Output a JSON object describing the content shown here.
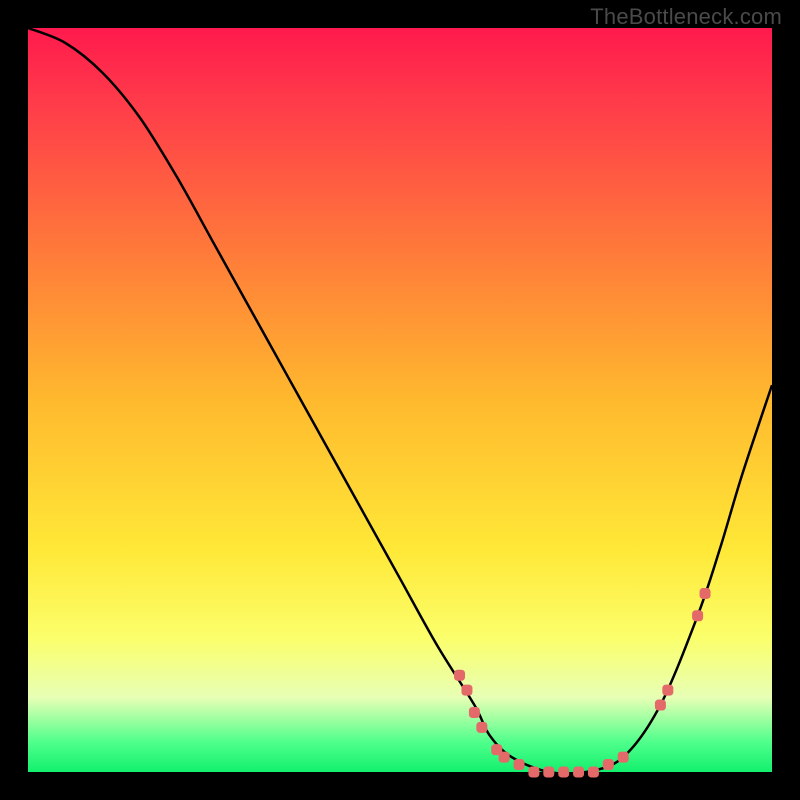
{
  "watermark": "TheBottleneck.com",
  "chart_data": {
    "type": "line",
    "title": "",
    "xlabel": "",
    "ylabel": "",
    "xlim": [
      0,
      100
    ],
    "ylim": [
      0,
      100
    ],
    "series": [
      {
        "name": "curve",
        "x": [
          0,
          5,
          10,
          15,
          20,
          25,
          30,
          35,
          40,
          45,
          50,
          55,
          60,
          62,
          65,
          70,
          75,
          80,
          85,
          90,
          93,
          96,
          100
        ],
        "y": [
          100,
          98,
          94,
          88,
          80,
          71,
          62,
          53,
          44,
          35,
          26,
          17,
          9,
          5,
          2,
          0,
          0,
          2,
          9,
          21,
          30,
          40,
          52
        ]
      }
    ],
    "markers": [
      {
        "x": 58,
        "y": 13
      },
      {
        "x": 59,
        "y": 11
      },
      {
        "x": 60,
        "y": 8
      },
      {
        "x": 61,
        "y": 6
      },
      {
        "x": 63,
        "y": 3
      },
      {
        "x": 64,
        "y": 2
      },
      {
        "x": 66,
        "y": 1
      },
      {
        "x": 68,
        "y": 0
      },
      {
        "x": 70,
        "y": 0
      },
      {
        "x": 72,
        "y": 0
      },
      {
        "x": 74,
        "y": 0
      },
      {
        "x": 76,
        "y": 0
      },
      {
        "x": 78,
        "y": 1
      },
      {
        "x": 80,
        "y": 2
      },
      {
        "x": 85,
        "y": 9
      },
      {
        "x": 86,
        "y": 11
      },
      {
        "x": 90,
        "y": 21
      },
      {
        "x": 91,
        "y": 24
      }
    ],
    "marker_color": "#e46a6a",
    "curve_color": "#000000"
  }
}
